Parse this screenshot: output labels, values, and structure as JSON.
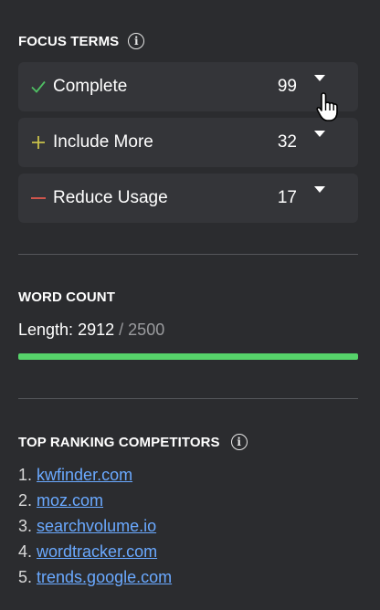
{
  "focus_terms": {
    "title": "FOCUS TERMS",
    "rows": [
      {
        "label": "Complete",
        "count": "99",
        "icon": "check-icon",
        "icon_color": "#4fbf63"
      },
      {
        "label": "Include More",
        "count": "32",
        "icon": "plus-icon",
        "icon_color": "#c9c14a"
      },
      {
        "label": "Reduce Usage",
        "count": "17",
        "icon": "minus-icon",
        "icon_color": "#e0594f"
      }
    ]
  },
  "word_count": {
    "title": "WORD COUNT",
    "length_label": "Length:",
    "current": "2912",
    "separator": "/",
    "target": "2500",
    "progress_fraction": 1.0,
    "bar_color": "#56d36a"
  },
  "competitors": {
    "title": "TOP RANKING COMPETITORS",
    "items": [
      {
        "num": "1.",
        "domain": "kwfinder.com"
      },
      {
        "num": "2.",
        "domain": "moz.com"
      },
      {
        "num": "3.",
        "domain": "searchvolume.io"
      },
      {
        "num": "4.",
        "domain": "wordtracker.com"
      },
      {
        "num": "5.",
        "domain": "trends.google.com"
      }
    ]
  },
  "info_icon_glyph": "i"
}
